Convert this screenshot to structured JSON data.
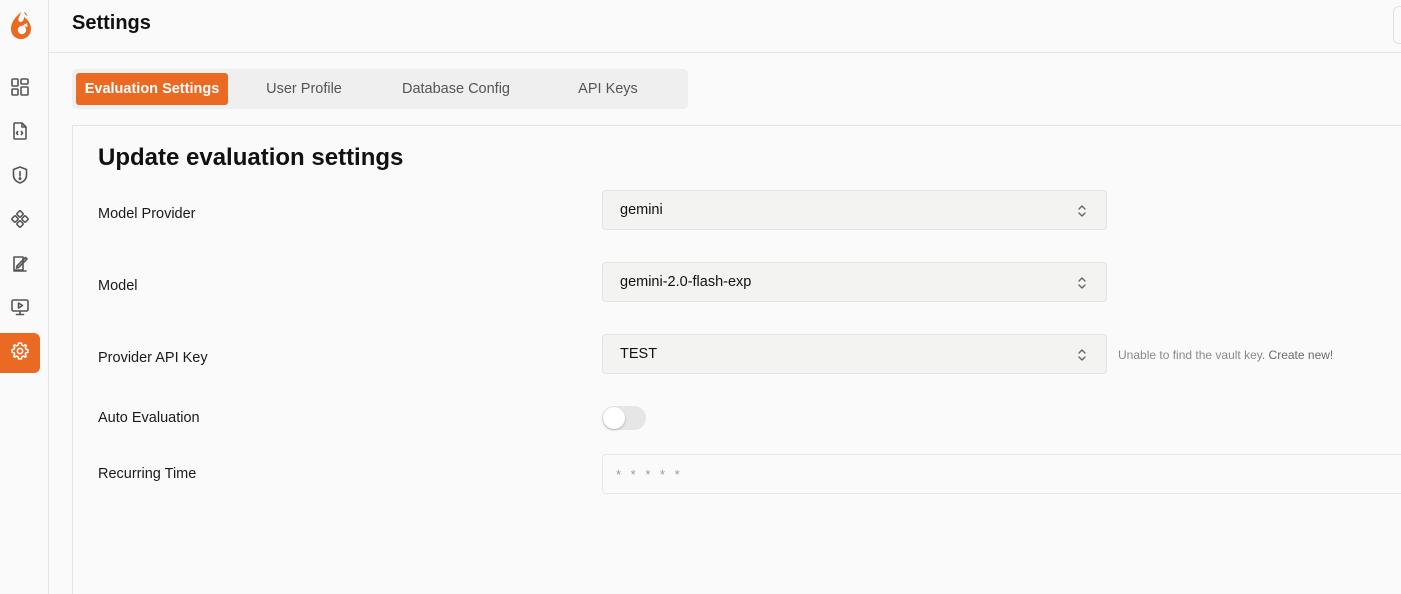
{
  "header": {
    "title": "Settings"
  },
  "sidebar": {
    "items": [
      {
        "name": "dashboard-icon"
      },
      {
        "name": "file-code-icon"
      },
      {
        "name": "shield-icon"
      },
      {
        "name": "integrations-icon"
      },
      {
        "name": "evaluations-icon"
      },
      {
        "name": "monitor-play-icon"
      },
      {
        "name": "gear-icon",
        "active": true
      }
    ],
    "accent": "#ea6a23"
  },
  "tabs": [
    {
      "label": "Evaluation Settings",
      "active": true
    },
    {
      "label": "User Profile"
    },
    {
      "label": "Database Config"
    },
    {
      "label": "API Keys"
    }
  ],
  "form": {
    "title": "Update evaluation settings",
    "model_provider": {
      "label": "Model Provider",
      "value": "gemini"
    },
    "model": {
      "label": "Model",
      "value": "gemini-2.0-flash-exp"
    },
    "provider_api_key": {
      "label": "Provider API Key",
      "value": "TEST",
      "hint": "Unable to find the vault key.",
      "hint_link": "Create new!"
    },
    "auto_evaluation": {
      "label": "Auto Evaluation",
      "enabled": false
    },
    "recurring_time": {
      "label": "Recurring Time",
      "placeholder": "* * * * *"
    }
  }
}
